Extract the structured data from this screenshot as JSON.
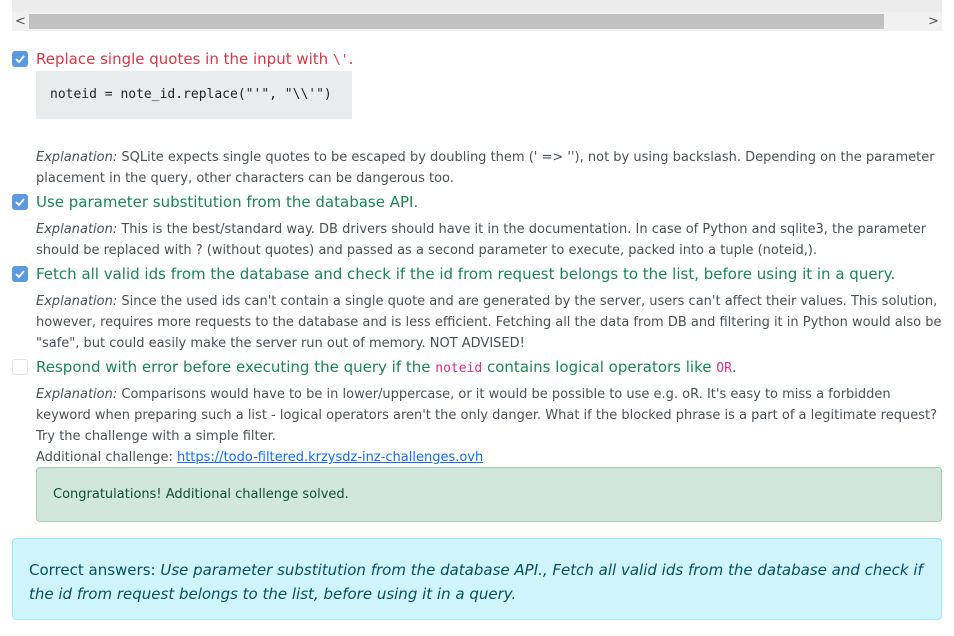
{
  "scrollbar": {
    "left_arrow": "<",
    "right_arrow": ">"
  },
  "options": [
    {
      "checked": true,
      "label_prefix": "Replace single quotes in the input with ",
      "label_code": "\\'",
      "label_suffix": ".",
      "code": "noteid = note_id.replace(\"'\", \"\\\\'\")",
      "explanation_lead": "Explanation:",
      "explanation": " SQLite expects single quotes to be escaped by doubling them (' => ''), not by using backslash. Depending on the parameter placement in the query, other characters can be dangerous too."
    },
    {
      "checked": true,
      "label": "Use parameter substitution from the database API.",
      "explanation_lead": "Explanation:",
      "explanation": " This is the best/standard way. DB drivers should have it in the documentation. In case of Python and sqlite3, the parameter should be replaced with ? (without quotes) and passed as a second parameter to execute, packed into a tuple (noteid,)."
    },
    {
      "checked": true,
      "label": "Fetch all valid ids from the database and check if the id from request belongs to the list, before using it in a query.",
      "explanation_lead": "Explanation:",
      "explanation": " Since the used ids can't contain a single quote and are generated by the server, users can't affect their values. This solution, however, requires more requests to the database and is less efficient. Fetching all the data from DB and filtering it in Python would also be \"safe\", but could easily make the server run out of memory. NOT ADVISED!"
    },
    {
      "checked": false,
      "label_prefix": "Respond with error before executing the query if the ",
      "label_code": "noteid",
      "label_middle": " contains logical operators like ",
      "label_code2": "OR",
      "label_suffix": ".",
      "explanation_lead": "Explanation:",
      "explanation": " Comparisons would have to be in lower/uppercase, or it would be possible to use e.g. oR. It's easy to miss a forbidden keyword when preparing such a list - logical operators aren't the only danger. What if the blocked phrase is a part of a legitimate request? Try the challenge with a simple filter.",
      "additional_label": "Additional challenge: ",
      "additional_link": "https://todo-filtered.krzysdz-inz-challenges.ovh"
    }
  ],
  "success_message": "Congratulations! Additional challenge solved.",
  "result": {
    "lead": "Correct answers: ",
    "answers": "Use parameter substitution from the database API., Fetch all valid ids from the database and check if the id from request belongs to the list, before using it in a query."
  },
  "colors": {
    "checkbox": "#5a9be0",
    "incorrect": "#dc3545",
    "correct": "#198754"
  }
}
